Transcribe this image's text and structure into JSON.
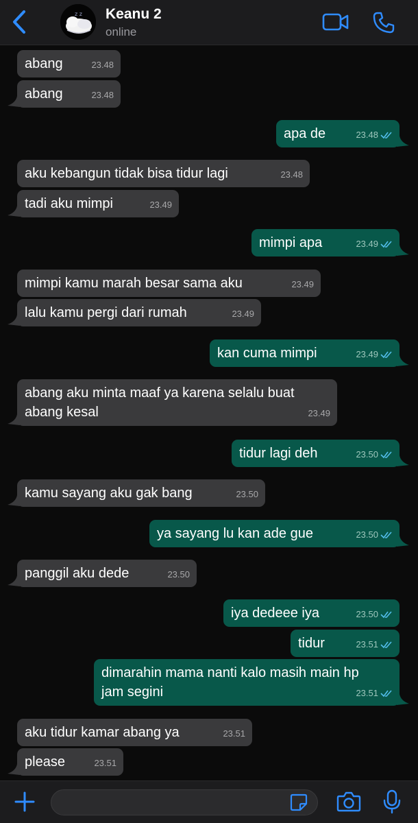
{
  "header": {
    "contact_name": "Keanu 2",
    "status": "online"
  },
  "colors": {
    "accent": "#2f8cff",
    "incoming_bubble": "#3a3a3c",
    "outgoing_bubble": "#08584a",
    "read_receipt": "#53bdeb"
  },
  "messages": [
    {
      "dir": "in",
      "text": "abang",
      "time": "23.48"
    },
    {
      "dir": "in",
      "text": "abang",
      "time": "23.48"
    },
    {
      "dir": "out",
      "text": "apa de",
      "time": "23.48",
      "read": true
    },
    {
      "dir": "in",
      "text": "aku kebangun tidak bisa tidur lagi",
      "time": "23.48"
    },
    {
      "dir": "in",
      "text": "tadi aku mimpi",
      "time": "23.49"
    },
    {
      "dir": "out",
      "text": "mimpi apa",
      "time": "23.49",
      "read": true
    },
    {
      "dir": "in",
      "text": "mimpi kamu marah besar sama aku",
      "time": "23.49"
    },
    {
      "dir": "in",
      "text": "lalu kamu pergi dari rumah",
      "time": "23.49"
    },
    {
      "dir": "out",
      "text": "kan cuma mimpi",
      "time": "23.49",
      "read": true
    },
    {
      "dir": "in",
      "lines": [
        "abang aku minta maaf ya karena selalu buat",
        "abang kesal"
      ],
      "time": "23.49"
    },
    {
      "dir": "out",
      "text": "tidur lagi deh",
      "time": "23.50",
      "read": true
    },
    {
      "dir": "in",
      "text": "kamu sayang aku gak bang",
      "time": "23.50"
    },
    {
      "dir": "out",
      "text": "ya sayang lu kan ade gue",
      "time": "23.50",
      "read": true
    },
    {
      "dir": "in",
      "text": "panggil aku dede",
      "time": "23.50"
    },
    {
      "dir": "out",
      "text": "iya dedeee iya",
      "time": "23.50",
      "read": true
    },
    {
      "dir": "out",
      "text": "tidur",
      "time": "23.51",
      "read": true
    },
    {
      "dir": "out",
      "lines": [
        "dimarahin mama nanti kalo masih main hp",
        "jam segini"
      ],
      "time": "23.51",
      "read": true
    },
    {
      "dir": "in",
      "text": "aku tidur kamar abang ya",
      "time": "23.51"
    },
    {
      "dir": "in",
      "text": "please",
      "time": "23.51"
    }
  ],
  "footer": {
    "input_value": "",
    "icons": [
      "plus-icon",
      "sticker-icon",
      "camera-icon",
      "microphone-icon"
    ]
  }
}
